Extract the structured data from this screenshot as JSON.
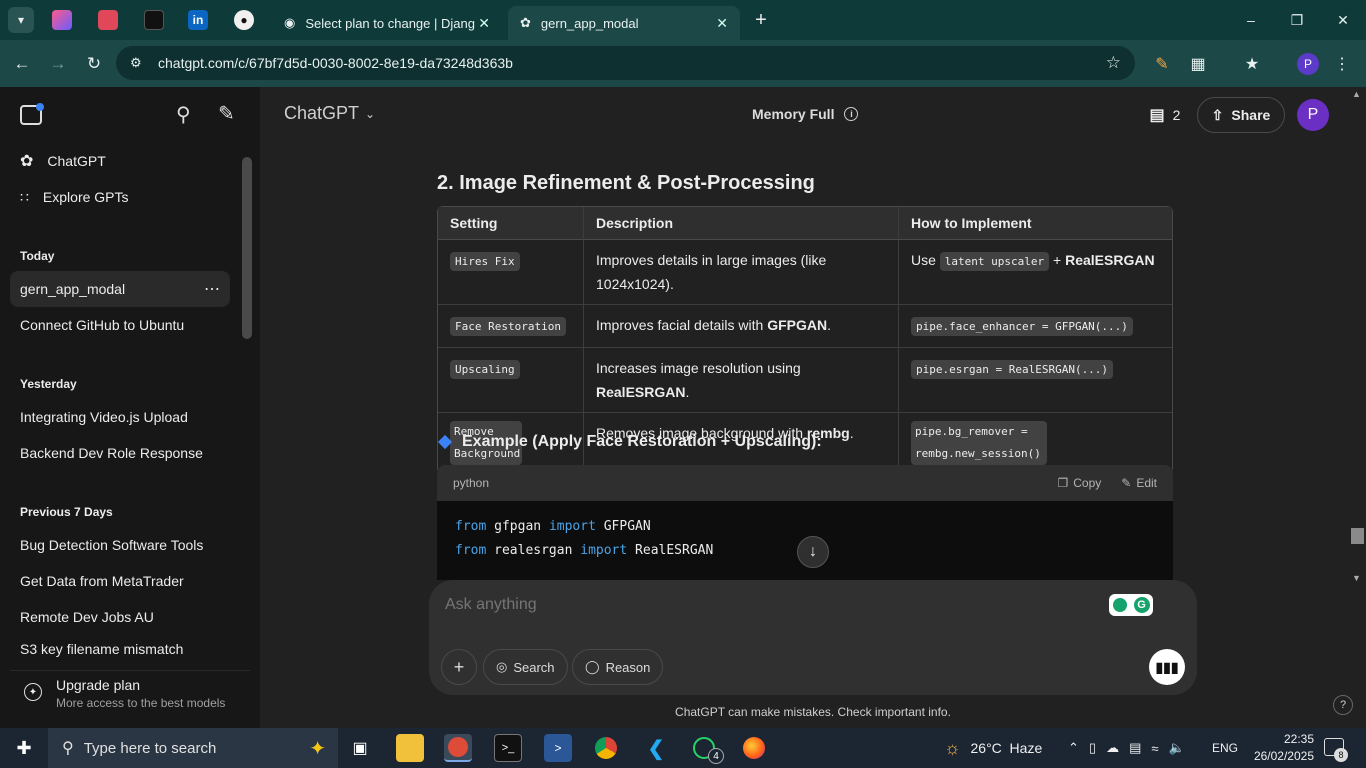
{
  "browser": {
    "tabs": [
      {
        "title": "Select plan to change | Django"
      },
      {
        "title": "gern_app_modal"
      }
    ],
    "new_tab": "+",
    "url": "chatgpt.com/c/67bf7d5d-0030-8002-8e19-da73248d363b",
    "profile_initial": "P"
  },
  "sidebar": {
    "top_items": [
      {
        "label": "ChatGPT"
      },
      {
        "label": "Explore GPTs"
      }
    ],
    "sections": [
      {
        "heading": "Today",
        "items": [
          "gern_app_modal",
          "Connect GitHub to Ubuntu"
        ]
      },
      {
        "heading": "Yesterday",
        "items": [
          "Integrating Video.js Upload",
          "Backend Dev Role Response"
        ]
      },
      {
        "heading": "Previous 7 Days",
        "items": [
          "Bug Detection Software Tools",
          "Get Data from MetaTrader",
          "Remote Dev Jobs AU",
          "S3 key filename mismatch"
        ]
      }
    ],
    "upgrade": {
      "title": "Upgrade plan",
      "subtitle": "More access to the best models"
    }
  },
  "header": {
    "model": "ChatGPT",
    "memory": "Memory Full",
    "count": "2",
    "share": "Share",
    "avatar": "P"
  },
  "content": {
    "section_title": "2. Image Refinement & Post-Processing",
    "table": {
      "headers": [
        "Setting",
        "Description",
        "How to Implement"
      ],
      "rows": [
        {
          "setting": "Hires Fix",
          "desc_pre": "Improves details in large images (like 1024x1024).",
          "desc_bold": "",
          "desc_post": "",
          "impl_pre": "Use",
          "impl_code": "latent upscaler",
          "impl_post": "+",
          "impl_bold": "RealESRGAN"
        },
        {
          "setting": "Face Restoration",
          "desc_pre": "Improves facial details with",
          "desc_bold": "GFPGAN",
          "desc_post": ".",
          "impl_pre": "",
          "impl_code": "pipe.face_enhancer = GFPGAN(...)",
          "impl_post": "",
          "impl_bold": ""
        },
        {
          "setting": "Upscaling",
          "desc_pre": "Increases image resolution using",
          "desc_bold": "RealESRGAN",
          "desc_post": ".",
          "impl_pre": "",
          "impl_code": "pipe.esrgan = RealESRGAN(...)",
          "impl_post": "",
          "impl_bold": ""
        },
        {
          "setting": "Remove Background",
          "desc_pre": "Removes image background with",
          "desc_bold": "rembg",
          "desc_post": ".",
          "impl_pre": "",
          "impl_code": "pipe.bg_remover = rembg.new_session()",
          "impl_post": "",
          "impl_bold": ""
        }
      ]
    },
    "example_heading": "Example (Apply Face Restoration + Upscaling):",
    "code": {
      "language": "python",
      "copy": "Copy",
      "edit": "Edit",
      "lines": [
        {
          "kw1": "from",
          "mod": "gfpgan",
          "kw2": "import",
          "name": "GFPGAN"
        },
        {
          "kw1": "from",
          "mod": "realesrgan",
          "kw2": "import",
          "name": "RealESRGAN"
        }
      ]
    }
  },
  "composer": {
    "placeholder": "Ask anything",
    "search": "Search",
    "reason": "Reason"
  },
  "disclaimer": "ChatGPT can make mistakes. Check important info.",
  "taskbar": {
    "search_placeholder": "Type here to search",
    "weather": "26°C  Haze",
    "lang": "ENG",
    "time": "22:35",
    "date": "26/02/2025",
    "notifications": "8",
    "badge_count": "4"
  }
}
